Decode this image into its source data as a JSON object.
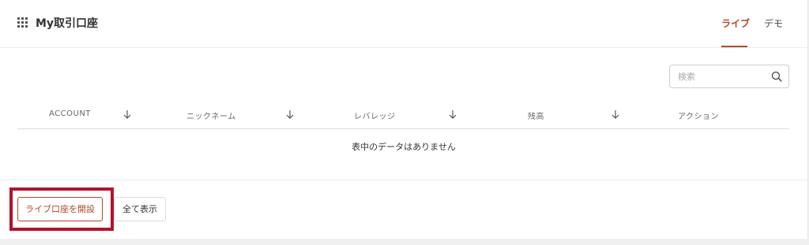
{
  "header": {
    "title": "My取引口座",
    "app_icon": "grid-icon",
    "tabs": [
      {
        "label": "ライブ",
        "active": true
      },
      {
        "label": "デモ",
        "active": false
      }
    ]
  },
  "search": {
    "placeholder": "検索",
    "icon": "search-icon"
  },
  "table": {
    "columns": [
      {
        "label": "ACCOUNT",
        "sortable": true
      },
      {
        "label": "ニックネーム",
        "sortable": true
      },
      {
        "label": "レバレッジ",
        "sortable": true
      },
      {
        "label": "残高",
        "sortable": true
      },
      {
        "label": "アクション",
        "sortable": false
      }
    ],
    "empty_message": "表中のデータはありません"
  },
  "footer": {
    "open_account_label": "ライブ口座を開設",
    "show_all_label": "全て表示"
  },
  "colors": {
    "accent": "#b5462a",
    "highlight_frame": "#b3122b"
  }
}
